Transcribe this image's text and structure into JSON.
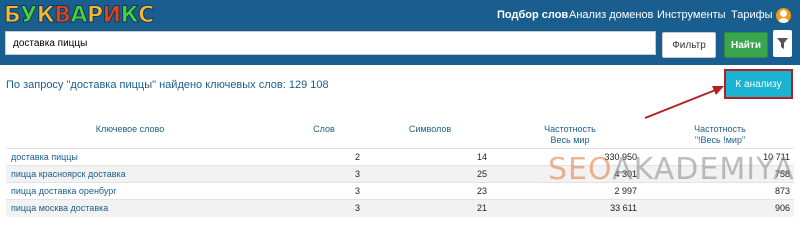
{
  "header": {
    "logo_text": "БУКВАРИКС",
    "logo_colors": [
      "#f7b731",
      "#4cd137",
      "#f7b731",
      "#e84118",
      "#4cd137",
      "#f7b731",
      "#e84118",
      "#4cd137",
      "#f7b731"
    ],
    "nav": [
      {
        "label": "Подбор слов",
        "active": true
      },
      {
        "label": "Анализ доменов",
        "active": false
      },
      {
        "label": "Инструменты",
        "active": false
      },
      {
        "label": "Тарифы",
        "active": false
      }
    ],
    "user_icon": "user-icon",
    "bg_color": "#1a5e8f"
  },
  "search": {
    "value": "доставка пиццы",
    "filter_label": "Фильтр",
    "find_label": "Найти",
    "filter_icon": "filter-icon"
  },
  "summary": "По запросу \"доставка пиццы\" найдено ключевых слов: 129 108",
  "analyze_button": "К анализу",
  "table": {
    "headers": {
      "keyword": "Ключевое слово",
      "words": "Слов",
      "symbols": "Символов",
      "freq_line1": "Частотность",
      "freq_line2": "Весь мир",
      "freq2_line1": "Частотность",
      "freq2_line2": "\"!Весь !мир\""
    },
    "rows": [
      {
        "keyword": "доставка пиццы",
        "words": "2",
        "symbols": "14",
        "freq": "330 950",
        "freq2": "10 711"
      },
      {
        "keyword": "пицца красноярск доставка",
        "words": "3",
        "symbols": "25",
        "freq": "4 301",
        "freq2": "758"
      },
      {
        "keyword": "пицца доставка оренбург",
        "words": "3",
        "symbols": "23",
        "freq": "2 997",
        "freq2": "873"
      },
      {
        "keyword": "пицца москва доставка",
        "words": "3",
        "symbols": "21",
        "freq": "33 611",
        "freq2": "906"
      }
    ]
  },
  "watermark": {
    "part1": "SEO",
    "part2": "AKADEMIYA"
  },
  "colors": {
    "accent": "#1a5e8f",
    "find_button": "#3aa54f",
    "analyze_button": "#1ab3d1",
    "highlight": "#b32020"
  }
}
